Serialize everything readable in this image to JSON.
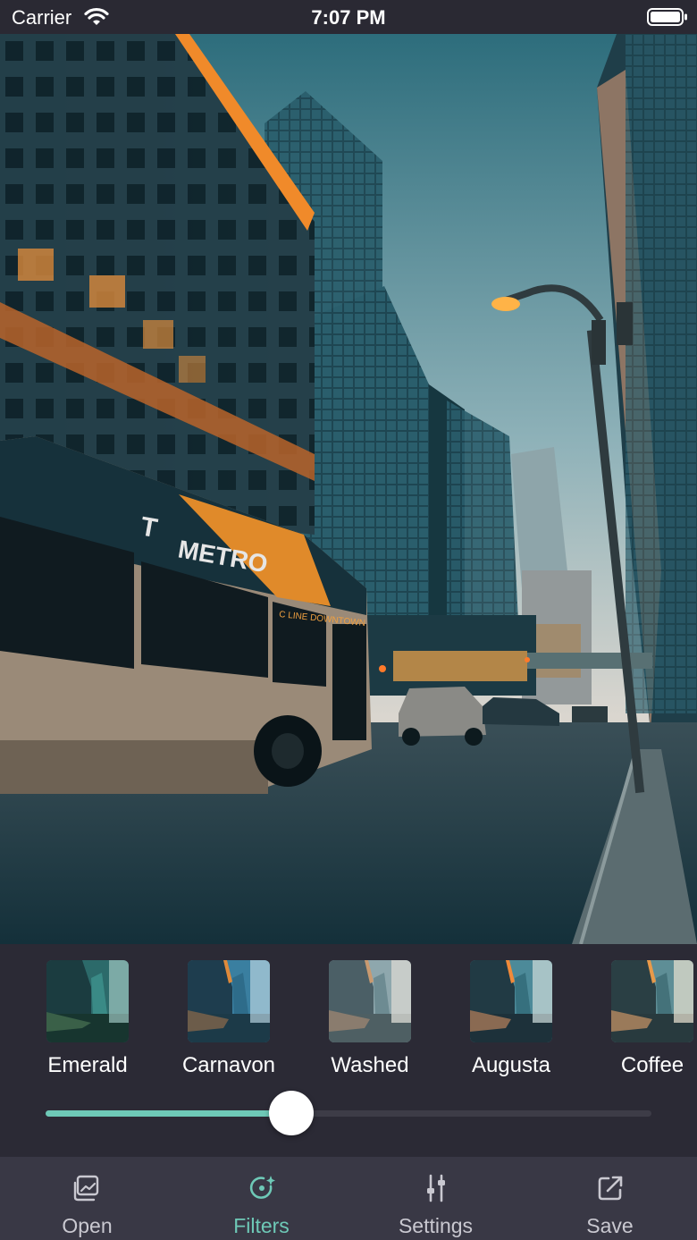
{
  "status_bar": {
    "carrier": "Carrier",
    "time": "7:07 PM"
  },
  "photo": {
    "bus_sign": "METRO",
    "bus_logo": "T",
    "destination_sign": "C LINE DOWNTOWN"
  },
  "filters": [
    {
      "label": "Emerald"
    },
    {
      "label": "Carnavon"
    },
    {
      "label": "Washed"
    },
    {
      "label": "Augusta"
    },
    {
      "label": "Coffee"
    }
  ],
  "intensity_slider": {
    "value": 0.37
  },
  "tab_bar": {
    "items": [
      {
        "label": "Open",
        "icon": "photo-check-icon"
      },
      {
        "label": "Filters",
        "icon": "filter-sparkle-icon"
      },
      {
        "label": "Settings",
        "icon": "sliders-icon"
      },
      {
        "label": "Save",
        "icon": "share-out-icon"
      }
    ],
    "active_index": 1
  },
  "colors": {
    "accent": "#6ec9b7",
    "panel": "#2b2a35",
    "tab_bar": "#393845",
    "inactive_text": "#c9c8d0"
  }
}
